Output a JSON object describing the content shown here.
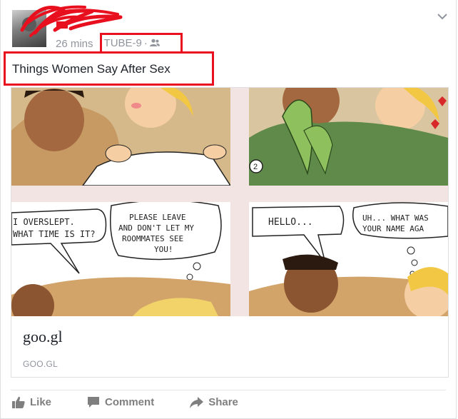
{
  "header": {
    "time": "26 mins",
    "group": "TUBE-9",
    "separator": "·",
    "privacy_icon": "friends-icon",
    "menu_icon": "chevron-down-icon"
  },
  "post": {
    "text": "Things Women Say After Sex"
  },
  "comic": {
    "panel3_line1": "I OVERSLEPT.",
    "panel3_line2": "WHAT TIME IS IT?",
    "panel3b_line1": "PLEASE LEAVE",
    "panel3b_line2": "AND DON'T LET MY",
    "panel3b_line3": "ROOMMATES SEE",
    "panel3b_line4": "YOU!",
    "panel4a": "HELLO...",
    "panel4b_line1": "UH... WHAT WAS",
    "panel4b_line2": "YOUR NAME AGA",
    "panel_number": "2"
  },
  "link": {
    "title": "goo.gl",
    "domain": "GOO.GL"
  },
  "actions": {
    "like": "Like",
    "comment": "Comment",
    "share": "Share"
  },
  "colors": {
    "highlight_red": "#e8101e",
    "link_blue": "#365899",
    "muted_gray": "#90949c"
  }
}
